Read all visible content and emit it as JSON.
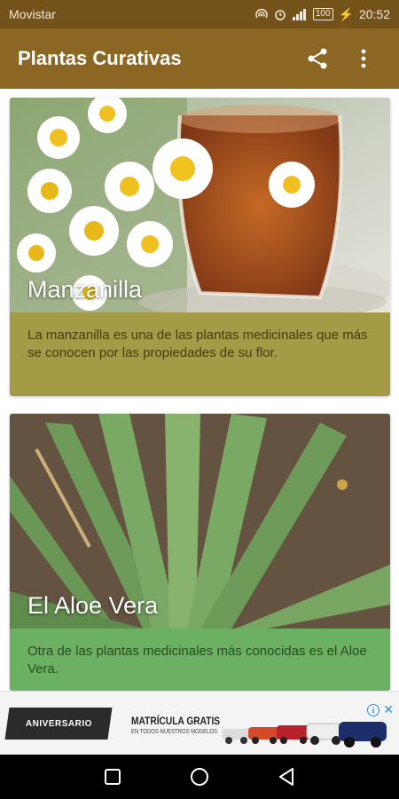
{
  "status_bar": {
    "carrier": "Movistar",
    "battery": "100",
    "time": "20:52"
  },
  "app_bar": {
    "title": "Plantas Curativas"
  },
  "cards": [
    {
      "title": "Manzanilla",
      "description": "La manzanilla es una de las plantas medicinales que más se conocen por las propiedades de su flor."
    },
    {
      "title": "El Aloe Vera",
      "description": "Otra de las plantas medicinales más conocidas es el Aloe Vera."
    }
  ],
  "ad": {
    "badge": "ANIVERSARIO",
    "headline": "MATRÍCULA GRATIS",
    "subline": "EN TODOS NUESTROS MODELOS",
    "info": "i",
    "close": "✕"
  },
  "colors": {
    "status_bar": "#74531a",
    "app_bar": "#8c6623",
    "card1_footer": "#a59a45",
    "card2_footer": "#6bb063"
  },
  "icons": {
    "share": "share-icon",
    "menu": "more-vert-icon",
    "recents": "recents-square-icon",
    "home": "home-circle-icon",
    "back": "back-triangle-icon"
  }
}
